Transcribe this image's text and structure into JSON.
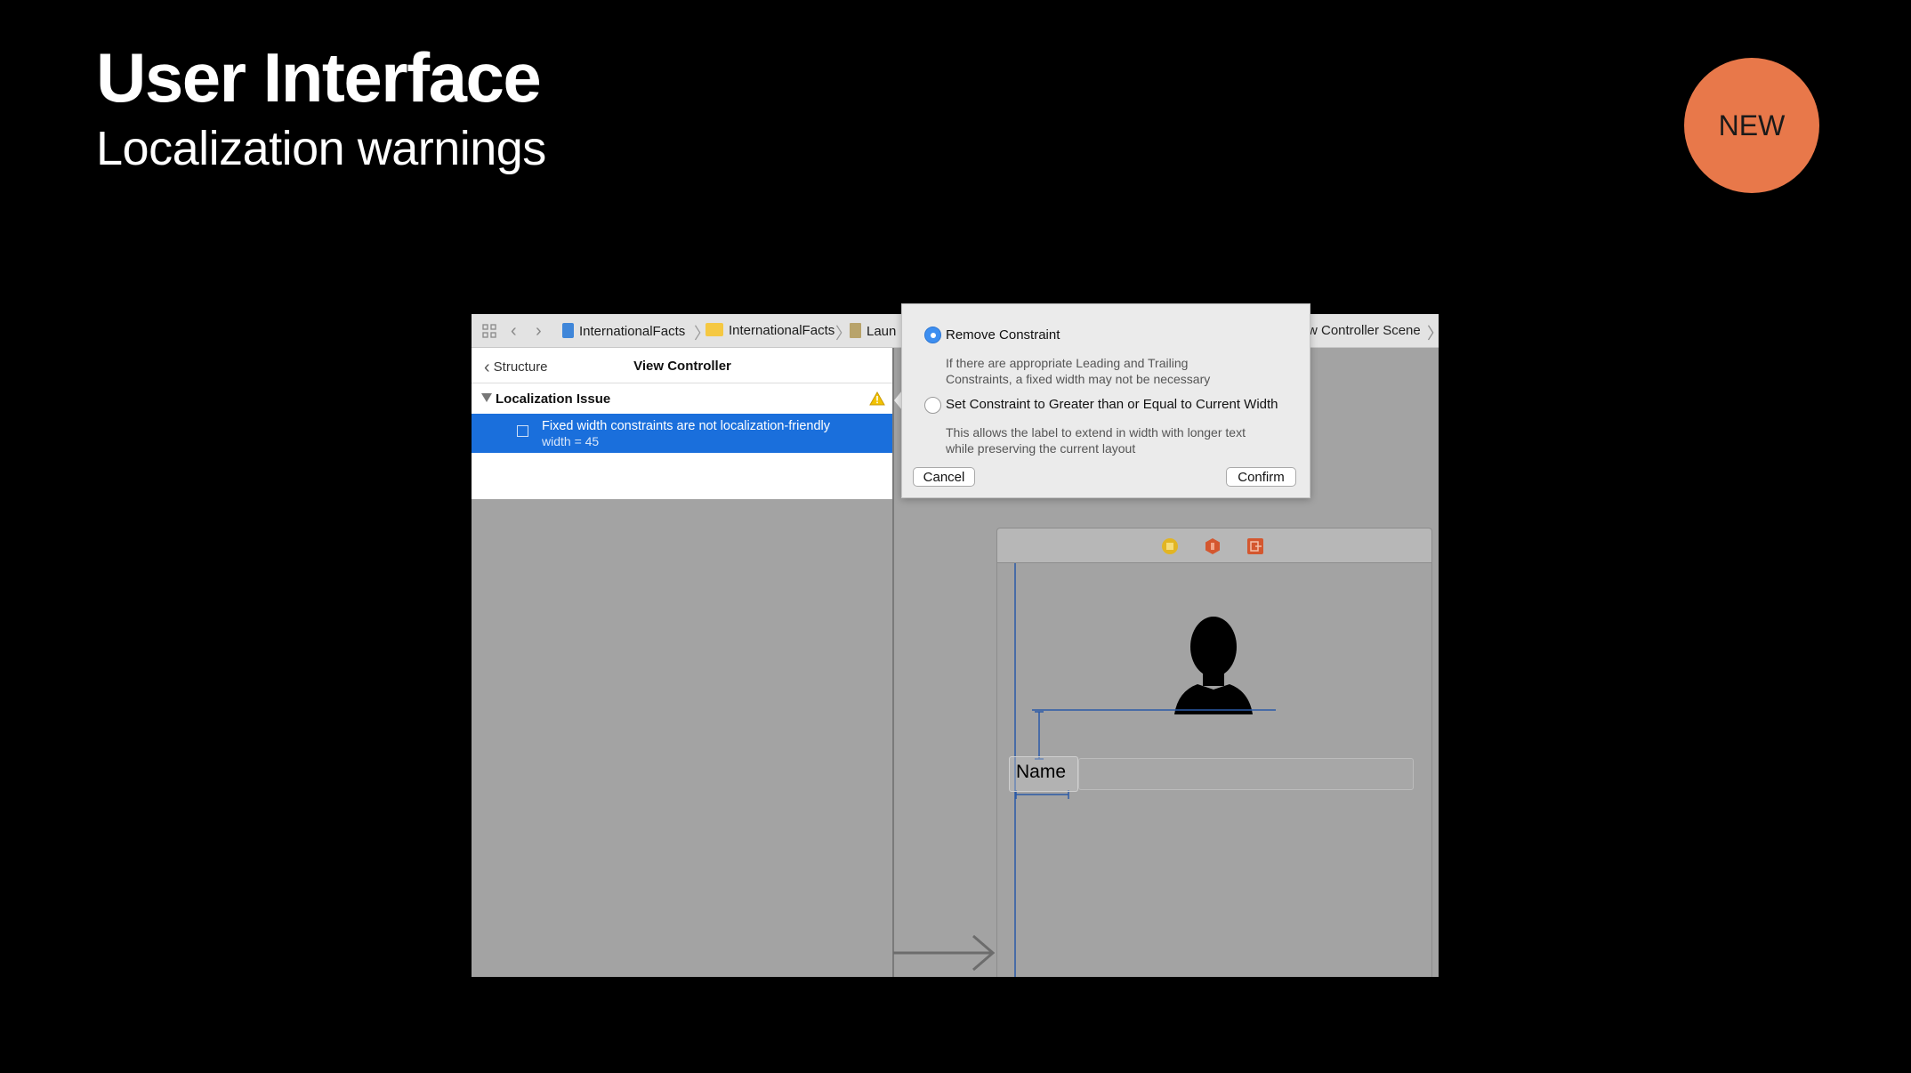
{
  "slide": {
    "title": "User Interface",
    "subtitle": "Localization warnings",
    "badge": "NEW"
  },
  "jumpbar": {
    "crumbs": [
      "InternationalFacts",
      "InternationalFacts",
      "Laun"
    ],
    "scene": "w Controller Scene"
  },
  "issues_panel": {
    "back_label": "Structure",
    "title": "View Controller",
    "group_label": "Localization Issue",
    "issue_text": "Fixed width constraints are not localization-friendly",
    "issue_detail": "width = 45"
  },
  "canvas": {
    "label_text": "Name"
  },
  "popover": {
    "option1_label": "Remove Constraint",
    "option1_desc_line1": "If there are appropriate Leading and Trailing",
    "option1_desc_line2": "Constraints, a fixed width may not be necessary",
    "option2_label": "Set Constraint to Greater than or Equal to Current Width",
    "option2_desc_line1": "This allows the label to extend in width with longer text",
    "option2_desc_line2": "while preserving the current layout",
    "cancel_label": "Cancel",
    "confirm_label": "Confirm",
    "selected_option": 1
  },
  "colors": {
    "badge": "#e8784a",
    "selection": "#1a6fdc",
    "warning": "#f2c200",
    "guide": "#2b5aa8"
  }
}
